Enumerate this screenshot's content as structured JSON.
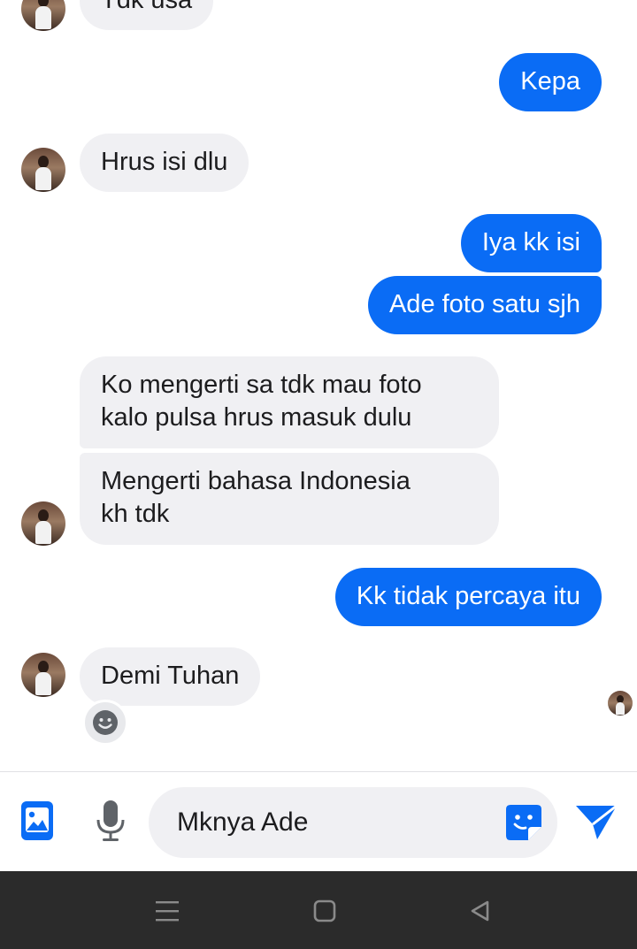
{
  "messages": [
    {
      "id": "m0",
      "direction": "incoming",
      "text": "Tdk usa"
    },
    {
      "id": "m1",
      "direction": "outgoing",
      "text": "Kepa"
    },
    {
      "id": "m2",
      "direction": "incoming",
      "text": "Hrus isi dlu"
    },
    {
      "id": "m3",
      "direction": "outgoing",
      "text": "Iya kk isi"
    },
    {
      "id": "m4",
      "direction": "outgoing",
      "text": "Ade foto satu sjh"
    },
    {
      "id": "m5",
      "direction": "incoming",
      "lines": [
        "Ko mengerti sa tdk mau foto",
        "kalo pulsa hrus masuk dulu"
      ]
    },
    {
      "id": "m6",
      "direction": "incoming",
      "lines": [
        "Mengerti bahasa Indonesia",
        "kh tdk"
      ]
    },
    {
      "id": "m7",
      "direction": "outgoing",
      "text": "Kk tidak percaya itu"
    },
    {
      "id": "m8",
      "direction": "incoming",
      "text": "Demi Tuhan"
    }
  ],
  "reaction": {
    "icon": "smiley-face-icon"
  },
  "composer": {
    "input_value": "Mknya Ade",
    "icons": [
      "gallery-icon",
      "microphone-icon",
      "sticker-icon",
      "send-icon"
    ],
    "accent_color": "#0a6cf5"
  },
  "navigation": {
    "icons": [
      "menu-icon",
      "home-icon",
      "back-icon"
    ]
  }
}
